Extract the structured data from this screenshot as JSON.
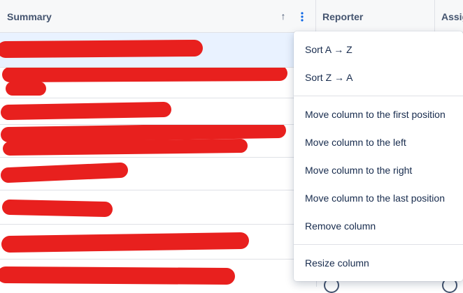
{
  "table": {
    "columns": [
      {
        "id": "summary",
        "label": "Summary"
      },
      {
        "id": "reporter",
        "label": "Reporter"
      },
      {
        "id": "assignee",
        "label": "Assig"
      }
    ],
    "sort_direction_icon": "arrow-up-icon",
    "sort_glyph": "↑",
    "column_menu_icon": "more-vertical-icon",
    "redaction_color": "#e8201e",
    "selected_row_color": "#e9f2ff",
    "accent_color": "#0c66e4"
  },
  "column_menu": {
    "groups": [
      [
        "Sort A → Z",
        "Sort Z → A"
      ],
      [
        "Move column to the first position",
        "Move column to the left",
        "Move column to the right",
        "Move column to the last position",
        "Remove column"
      ],
      [
        "Resize column"
      ]
    ]
  }
}
